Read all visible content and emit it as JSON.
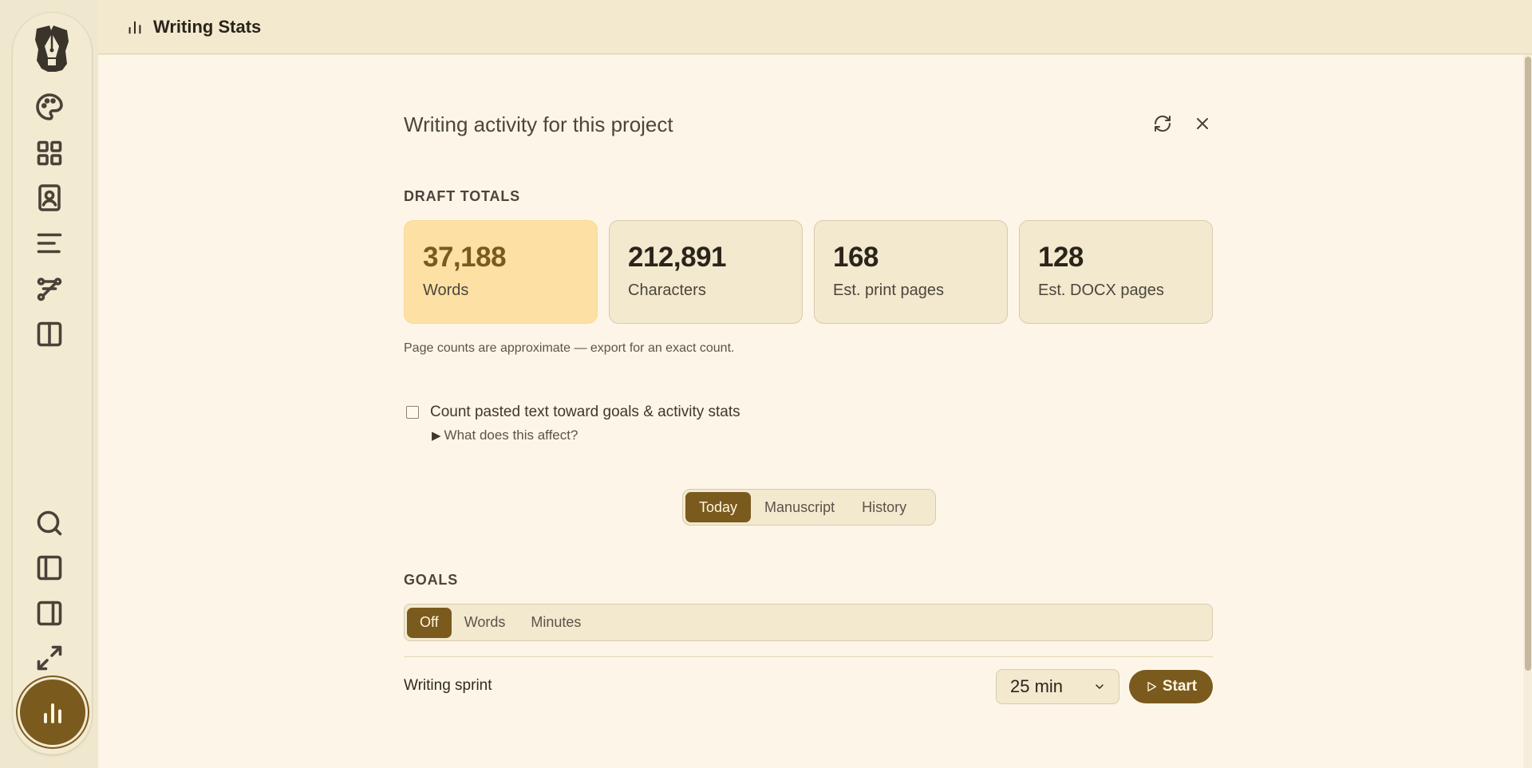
{
  "header": {
    "title": "Writing Stats",
    "icon": "bar-chart-icon"
  },
  "sidebar": {
    "top_icons": [
      "palette-icon",
      "grid-icon",
      "contact-book-icon",
      "align-left-icon",
      "flow-icon",
      "split-panel-icon"
    ],
    "bottom_icons": [
      "search-icon",
      "left-panel-icon",
      "right-panel-icon",
      "expand-icon"
    ],
    "active_icon": "bar-chart-icon"
  },
  "panel": {
    "title": "Writing activity for this project"
  },
  "draft_totals": {
    "label": "DRAFT TOTALS",
    "cards": [
      {
        "value": "37,188",
        "label": "Words"
      },
      {
        "value": "212,891",
        "label": "Characters"
      },
      {
        "value": "168",
        "label": "Est. print pages"
      },
      {
        "value": "128",
        "label": "Est. DOCX pages"
      }
    ],
    "note": "Page counts are approximate — export for an exact count."
  },
  "paste_option": {
    "label": "Count pasted text toward goals & activity stats",
    "checked": false,
    "details": "What does this affect?"
  },
  "view_tabs": {
    "items": [
      "Today",
      "Manuscript",
      "History"
    ],
    "active": "Today"
  },
  "goals": {
    "label": "GOALS",
    "options": [
      "Off",
      "Words",
      "Minutes"
    ],
    "active": "Off"
  },
  "sprint": {
    "label": "Writing sprint",
    "duration": "25 min",
    "start_label": "Start"
  },
  "colors": {
    "accent": "#7a5a1d",
    "highlight_card": "#fde0a4",
    "background": "#fdf6e8"
  }
}
